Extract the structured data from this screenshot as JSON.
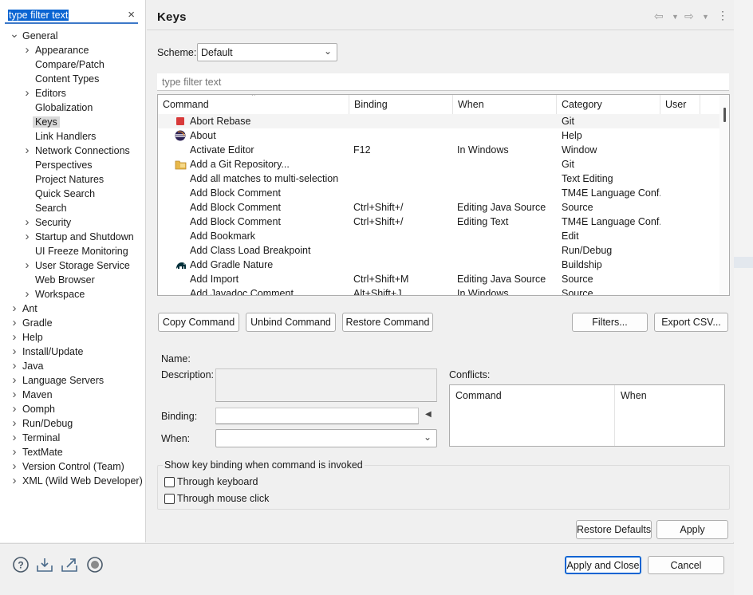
{
  "left": {
    "filter_text": "type filter text",
    "tree": [
      {
        "label": "General",
        "level": 0,
        "expanded": true
      },
      {
        "label": "Appearance",
        "level": 1,
        "expandable": true
      },
      {
        "label": "Compare/Patch",
        "level": 1
      },
      {
        "label": "Content Types",
        "level": 1
      },
      {
        "label": "Editors",
        "level": 1,
        "expandable": true
      },
      {
        "label": "Globalization",
        "level": 1
      },
      {
        "label": "Keys",
        "level": 1,
        "selected": true
      },
      {
        "label": "Link Handlers",
        "level": 1
      },
      {
        "label": "Network Connections",
        "level": 1,
        "expandable": true
      },
      {
        "label": "Perspectives",
        "level": 1
      },
      {
        "label": "Project Natures",
        "level": 1
      },
      {
        "label": "Quick Search",
        "level": 1
      },
      {
        "label": "Search",
        "level": 1
      },
      {
        "label": "Security",
        "level": 1,
        "expandable": true
      },
      {
        "label": "Startup and Shutdown",
        "level": 1,
        "expandable": true
      },
      {
        "label": "UI Freeze Monitoring",
        "level": 1
      },
      {
        "label": "User Storage Service",
        "level": 1,
        "expandable": true
      },
      {
        "label": "Web Browser",
        "level": 1
      },
      {
        "label": "Workspace",
        "level": 1,
        "expandable": true
      },
      {
        "label": "Ant",
        "level": 0,
        "expandable": true
      },
      {
        "label": "Gradle",
        "level": 0,
        "expandable": true
      },
      {
        "label": "Help",
        "level": 0,
        "expandable": true
      },
      {
        "label": "Install/Update",
        "level": 0,
        "expandable": true
      },
      {
        "label": "Java",
        "level": 0,
        "expandable": true
      },
      {
        "label": "Language Servers",
        "level": 0,
        "expandable": true
      },
      {
        "label": "Maven",
        "level": 0,
        "expandable": true
      },
      {
        "label": "Oomph",
        "level": 0,
        "expandable": true
      },
      {
        "label": "Run/Debug",
        "level": 0,
        "expandable": true
      },
      {
        "label": "Terminal",
        "level": 0,
        "expandable": true
      },
      {
        "label": "TextMate",
        "level": 0,
        "expandable": true
      },
      {
        "label": "Version Control (Team)",
        "level": 0,
        "expandable": true
      },
      {
        "label": "XML (Wild Web Developer)",
        "level": 0,
        "expandable": true
      }
    ]
  },
  "page": {
    "title": "Keys",
    "scheme_label": "Scheme:",
    "scheme_value": "Default",
    "command_filter_placeholder": "type filter text"
  },
  "table": {
    "columns": [
      "Command",
      "Binding",
      "When",
      "Category",
      "User"
    ],
    "rows": [
      {
        "command": "Abort Rebase",
        "binding": "",
        "when": "",
        "category": "Git",
        "user": "",
        "icon": "red-square-icon"
      },
      {
        "command": "About",
        "binding": "",
        "when": "",
        "category": "Help",
        "user": "",
        "icon": "eclipse-logo-icon"
      },
      {
        "command": "Activate Editor",
        "binding": "F12",
        "when": "In Windows",
        "category": "Window",
        "user": ""
      },
      {
        "command": "Add a Git Repository...",
        "binding": "",
        "when": "",
        "category": "Git",
        "user": "",
        "icon": "git-repo-folder-icon"
      },
      {
        "command": "Add all matches to multi-selection",
        "binding": "",
        "when": "",
        "category": "Text Editing",
        "user": ""
      },
      {
        "command": "Add Block Comment",
        "binding": "",
        "when": "",
        "category": "TM4E Language Conf...",
        "user": ""
      },
      {
        "command": "Add Block Comment",
        "binding": "Ctrl+Shift+/",
        "when": "Editing Java Source",
        "category": "Source",
        "user": ""
      },
      {
        "command": "Add Block Comment",
        "binding": "Ctrl+Shift+/",
        "when": "Editing Text",
        "category": "TM4E Language Conf...",
        "user": ""
      },
      {
        "command": "Add Bookmark",
        "binding": "",
        "when": "",
        "category": "Edit",
        "user": ""
      },
      {
        "command": "Add Class Load Breakpoint",
        "binding": "",
        "when": "",
        "category": "Run/Debug",
        "user": ""
      },
      {
        "command": "Add Gradle Nature",
        "binding": "",
        "when": "",
        "category": "Buildship",
        "user": "",
        "icon": "gradle-elephant-icon"
      },
      {
        "command": "Add Import",
        "binding": "Ctrl+Shift+M",
        "when": "Editing Java Source",
        "category": "Source",
        "user": ""
      },
      {
        "command": "Add Javadoc Comment",
        "binding": "Alt+Shift+J",
        "when": "In Windows",
        "category": "Source",
        "user": ""
      }
    ]
  },
  "buttons": {
    "copy_command": "Copy Command",
    "unbind_command": "Unbind Command",
    "restore_command": "Restore Command",
    "filters": "Filters...",
    "export_csv": "Export CSV...",
    "restore_defaults": "Restore Defaults",
    "apply": "Apply",
    "apply_and_close": "Apply and Close",
    "cancel": "Cancel"
  },
  "details": {
    "name_label": "Name:",
    "description_label": "Description:",
    "binding_label": "Binding:",
    "when_label": "When:",
    "conflicts_label": "Conflicts:",
    "conflicts_columns": [
      "Command",
      "When"
    ]
  },
  "show_binding": {
    "legend": "Show key binding when command is invoked",
    "keyboard_label": "Through keyboard",
    "mouse_label": "Through mouse click"
  },
  "colors": {
    "accent": "#0a64d2",
    "panel": "#f0f0f0",
    "selection": "#d9d9d9"
  }
}
